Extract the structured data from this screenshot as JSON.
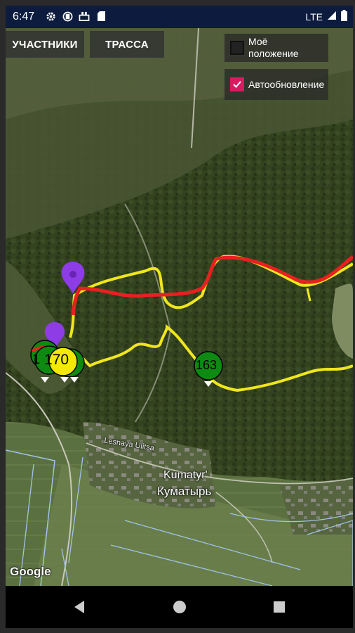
{
  "status_bar": {
    "time": "6:47",
    "left_icons": [
      "gear-icon",
      "vpn-icon",
      "usb-icon",
      "sd-card-icon"
    ],
    "network": "LTE",
    "right_icons": [
      "signal-icon",
      "battery-icon"
    ]
  },
  "map_controls": {
    "participants_button": "УЧАСТНИКИ",
    "track_button": "ТРАССА",
    "my_position": {
      "label": "Моё положение",
      "checked": false
    },
    "auto_update": {
      "label": "Автообновление",
      "checked": true
    }
  },
  "map": {
    "road_label": "Lesnaya Ulitsa",
    "place_latin": "Kumatyr'",
    "place_cyrillic": "Куматырь",
    "attribution": "Google",
    "route_colors": {
      "track": "#f0e61e",
      "participant_path": "#e82020",
      "marker_pin": "#8e3ce6",
      "participant_marker": "#0e8a12"
    },
    "participant_markers": [
      {
        "number": "1",
        "color": "#0e8a12"
      },
      {
        "number": "170",
        "color": "#f2e80a"
      },
      {
        "number": "163",
        "color": "#0e8a12"
      }
    ]
  },
  "nav_bar": {
    "back": "back-icon",
    "home": "home-icon",
    "recents": "recents-icon"
  }
}
